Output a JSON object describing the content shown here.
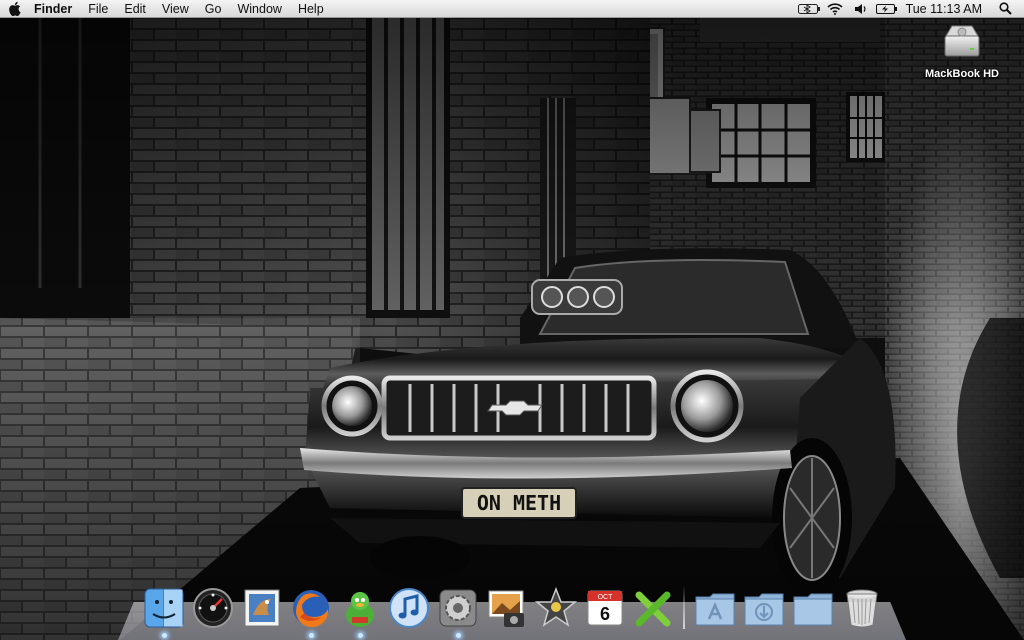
{
  "menubar": {
    "app_name": "Finder",
    "menus": [
      "File",
      "Edit",
      "View",
      "Go",
      "Window",
      "Help"
    ],
    "clock": "Tue 11:13 AM",
    "status_icons": [
      "bluetooth-battery-icon",
      "wifi-icon",
      "volume-icon",
      "battery-icon",
      "spotlight-icon"
    ]
  },
  "desktop": {
    "icons": [
      {
        "label": "MackBook HD",
        "icon": "hard-drive-icon"
      }
    ],
    "wallpaper": {
      "plate_text": "ON METH"
    }
  },
  "dock": {
    "items": [
      {
        "name": "finder",
        "running": true
      },
      {
        "name": "dashboard",
        "running": false
      },
      {
        "name": "mail",
        "running": false
      },
      {
        "name": "firefox",
        "running": true
      },
      {
        "name": "adium",
        "running": true
      },
      {
        "name": "itunes",
        "running": false
      },
      {
        "name": "system-preferences",
        "running": true
      },
      {
        "name": "iphoto",
        "running": false
      },
      {
        "name": "imovie",
        "running": false
      },
      {
        "name": "ical",
        "running": false
      },
      {
        "name": "x-app",
        "running": false
      }
    ],
    "calendar": {
      "month": "OCT",
      "day": "6"
    },
    "stacks": [
      "applications-folder",
      "downloads-folder",
      "documents-folder",
      "trash"
    ]
  }
}
